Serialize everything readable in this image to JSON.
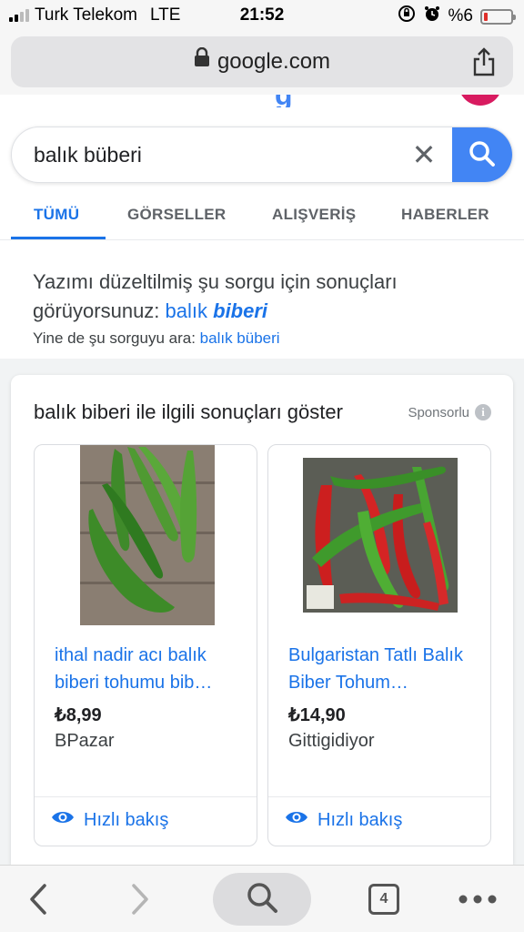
{
  "status_bar": {
    "carrier": "Turk Telekom",
    "network": "LTE",
    "time": "21:52",
    "battery": "%6",
    "battery_color": "#e0302b"
  },
  "browser": {
    "url": "google.com",
    "icons": [
      "lock-icon",
      "share-icon"
    ]
  },
  "search": {
    "query": "balık büberi",
    "clear_icon": "close-icon",
    "button_icon": "search-icon",
    "accent": "#4285f4"
  },
  "tabs": [
    {
      "label": "TÜMÜ",
      "active": true
    },
    {
      "label": "GÖRSELLER",
      "active": false
    },
    {
      "label": "ALIŞVERİŞ",
      "active": false
    },
    {
      "label": "HABERLER",
      "active": false
    }
  ],
  "spelling": {
    "prefix": "Yazımı düzeltilmiş şu sorgu için sonuçları görüyorsunuz: ",
    "corrected_plain": "balık ",
    "corrected_bold": "biberi",
    "alt_prefix": "Yine de şu sorguyu ara: ",
    "alt_query": "balık büberi"
  },
  "shopping": {
    "title": "balık biberi ile ilgili sonuçları göster",
    "sponsored": "Sponsorlu",
    "info_icon": "i",
    "products": [
      {
        "name": "ithal nadir acı balık biberi tohumu bib…",
        "price": "₺8,99",
        "seller": "BPazar",
        "quick_view": "Hızlı bakış"
      },
      {
        "name": "Bulgaristan Tatlı Balık Biber Tohum…",
        "price": "₺14,90",
        "seller": "Gittigidiyor",
        "quick_view": "Hızlı bakış"
      }
    ]
  },
  "toolbar": {
    "tab_count": "4",
    "icons": [
      "back-icon",
      "forward-icon",
      "search-icon",
      "tabs-icon",
      "more-icon"
    ]
  }
}
